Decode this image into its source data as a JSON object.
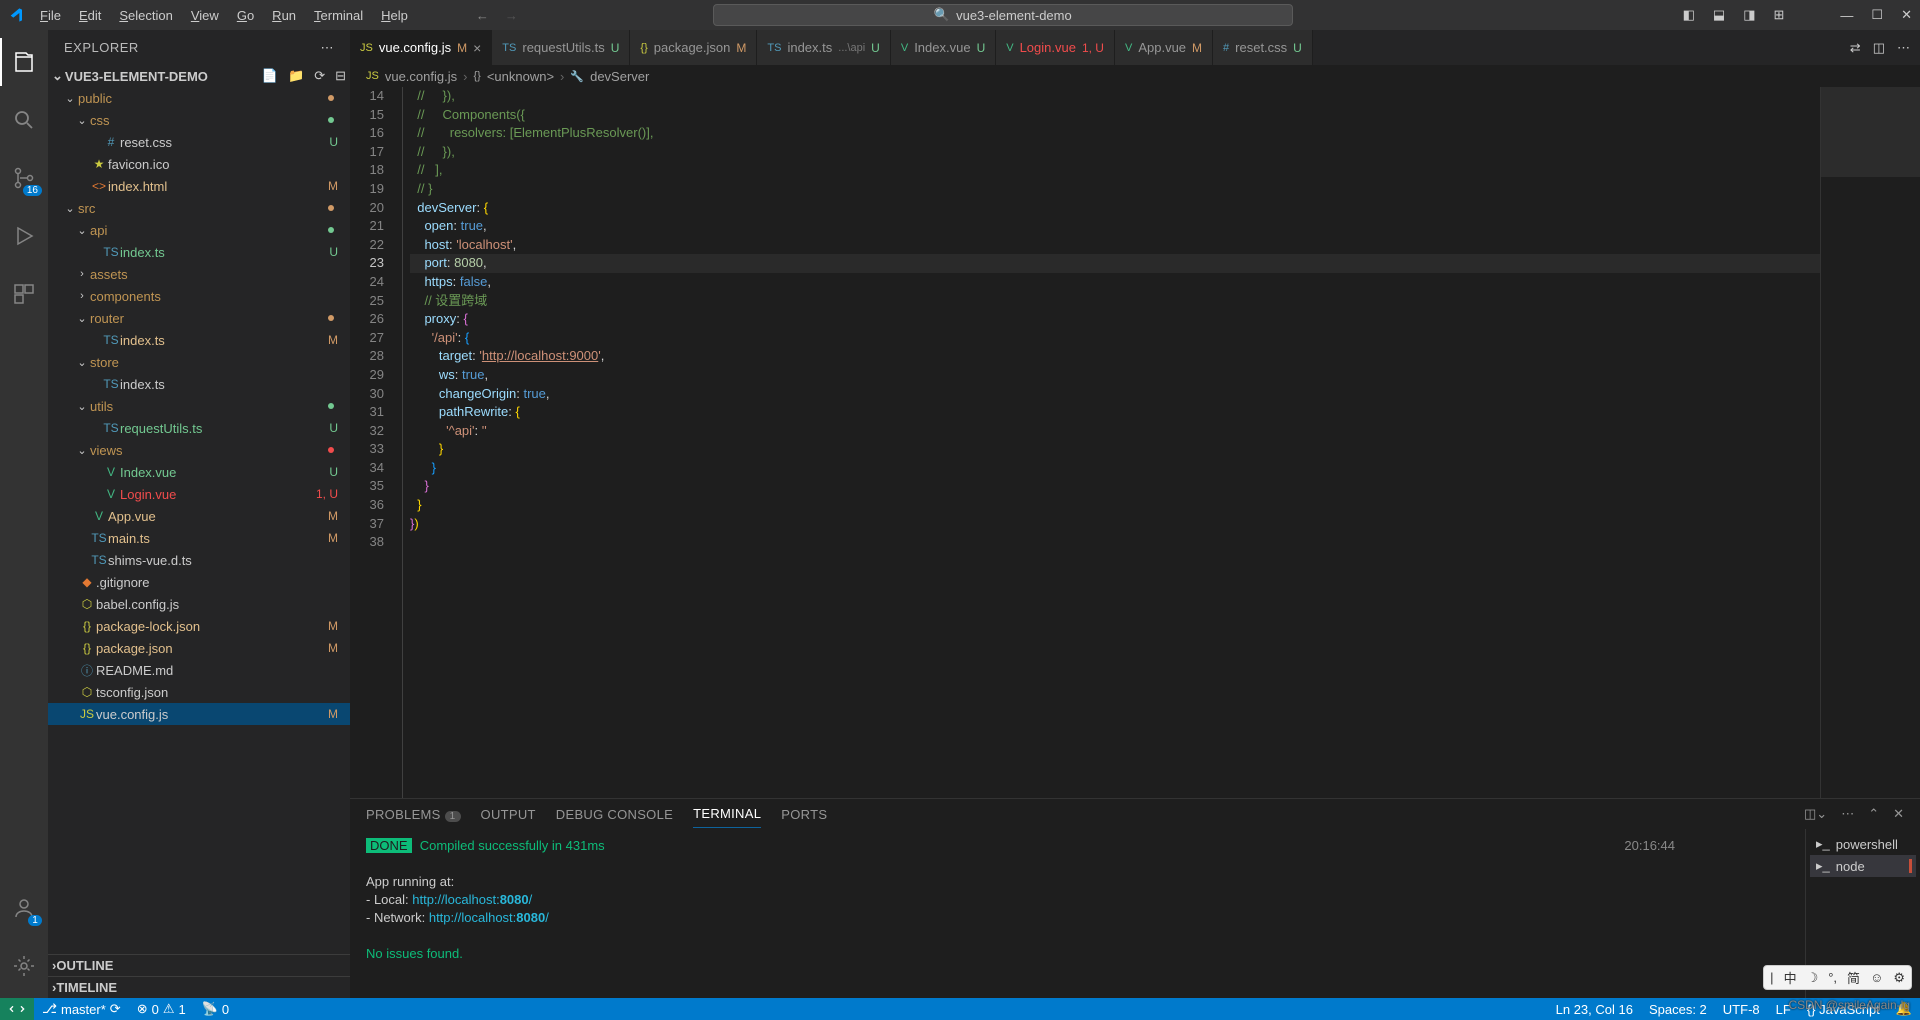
{
  "title": "vue3-element-demo",
  "menu": [
    "File",
    "Edit",
    "Selection",
    "View",
    "Go",
    "Run",
    "Terminal",
    "Help"
  ],
  "explorer": {
    "label": "EXPLORER",
    "project": "VUE3-ELEMENT-DEMO",
    "outline": "OUTLINE",
    "timeline": "TIMELINE"
  },
  "tree": [
    {
      "d": 0,
      "type": "folder",
      "open": true,
      "name": "public",
      "dot": "dot-M"
    },
    {
      "d": 1,
      "type": "folder",
      "open": true,
      "name": "css",
      "dot": "dot-U"
    },
    {
      "d": 2,
      "type": "file",
      "icon": "#",
      "cls": "col-css",
      "name": "reset.css",
      "status": "U",
      "scls": "st-U"
    },
    {
      "d": 1,
      "type": "file",
      "icon": "★",
      "cls": "col-ico",
      "name": "favicon.ico"
    },
    {
      "d": 1,
      "type": "file",
      "icon": "<>",
      "cls": "col-html",
      "name": "index.html",
      "status": "M",
      "scls": "st-M",
      "lcls": "label-yellow"
    },
    {
      "d": 0,
      "type": "folder",
      "open": true,
      "name": "src",
      "dot": "dot-M"
    },
    {
      "d": 1,
      "type": "folder",
      "open": true,
      "name": "api",
      "dot": "dot-U"
    },
    {
      "d": 2,
      "type": "file",
      "icon": "TS",
      "cls": "col-ts",
      "name": "index.ts",
      "status": "U",
      "scls": "st-U",
      "lcls": "label-green"
    },
    {
      "d": 1,
      "type": "folder",
      "open": false,
      "name": "assets"
    },
    {
      "d": 1,
      "type": "folder",
      "open": false,
      "name": "components"
    },
    {
      "d": 1,
      "type": "folder",
      "open": true,
      "name": "router",
      "dot": "dot-M"
    },
    {
      "d": 2,
      "type": "file",
      "icon": "TS",
      "cls": "col-ts",
      "name": "index.ts",
      "status": "M",
      "scls": "st-M",
      "lcls": "label-yellow"
    },
    {
      "d": 1,
      "type": "folder",
      "open": true,
      "name": "store"
    },
    {
      "d": 2,
      "type": "file",
      "icon": "TS",
      "cls": "col-ts",
      "name": "index.ts"
    },
    {
      "d": 1,
      "type": "folder",
      "open": true,
      "name": "utils",
      "dot": "dot-U"
    },
    {
      "d": 2,
      "type": "file",
      "icon": "TS",
      "cls": "col-ts",
      "name": "requestUtils.ts",
      "status": "U",
      "scls": "st-U",
      "lcls": "label-green"
    },
    {
      "d": 1,
      "type": "folder",
      "open": true,
      "name": "views",
      "dot": "dot-1"
    },
    {
      "d": 2,
      "type": "file",
      "icon": "V",
      "cls": "col-vue",
      "name": "Index.vue",
      "status": "U",
      "scls": "st-U",
      "lcls": "label-green"
    },
    {
      "d": 2,
      "type": "file",
      "icon": "V",
      "cls": "col-vue",
      "name": "Login.vue",
      "status": "1, U",
      "scls": "st-1U",
      "lcls": "label-red"
    },
    {
      "d": 1,
      "type": "file",
      "icon": "V",
      "cls": "col-vue",
      "name": "App.vue",
      "status": "M",
      "scls": "st-M",
      "lcls": "label-yellow"
    },
    {
      "d": 1,
      "type": "file",
      "icon": "TS",
      "cls": "col-ts",
      "name": "main.ts",
      "status": "M",
      "scls": "st-M",
      "lcls": "label-yellow"
    },
    {
      "d": 1,
      "type": "file",
      "icon": "TS",
      "cls": "col-ts",
      "name": "shims-vue.d.ts"
    },
    {
      "d": 0,
      "type": "file",
      "icon": "◆",
      "cls": "col-git",
      "name": ".gitignore"
    },
    {
      "d": 0,
      "type": "file",
      "icon": "⬡",
      "cls": "col-js",
      "name": "babel.config.js"
    },
    {
      "d": 0,
      "type": "file",
      "icon": "{}",
      "cls": "col-json",
      "name": "package-lock.json",
      "status": "M",
      "scls": "st-M",
      "lcls": "label-yellow"
    },
    {
      "d": 0,
      "type": "file",
      "icon": "{}",
      "cls": "col-json",
      "name": "package.json",
      "status": "M",
      "scls": "st-M",
      "lcls": "label-yellow"
    },
    {
      "d": 0,
      "type": "file",
      "icon": "ⓘ",
      "cls": "col-info",
      "name": "README.md"
    },
    {
      "d": 0,
      "type": "file",
      "icon": "⬡",
      "cls": "col-json",
      "name": "tsconfig.json"
    },
    {
      "d": 0,
      "type": "file",
      "icon": "JS",
      "cls": "col-js",
      "name": "vue.config.js",
      "status": "M",
      "scls": "st-M",
      "sel": true
    }
  ],
  "tabs": [
    {
      "icon": "JS",
      "cls": "col-js",
      "name": "vue.config.js",
      "st": "M",
      "scls": "st-M",
      "active": true,
      "close": true
    },
    {
      "icon": "TS",
      "cls": "col-ts",
      "name": "requestUtils.ts",
      "st": "U",
      "scls": "st-U"
    },
    {
      "icon": "{}",
      "cls": "col-json",
      "name": "package.json",
      "st": "M",
      "scls": "st-M"
    },
    {
      "icon": "TS",
      "cls": "col-ts",
      "name": "index.ts",
      "suffix": "...\\api",
      "st": "U",
      "scls": "st-U"
    },
    {
      "icon": "V",
      "cls": "col-vue",
      "name": "Index.vue",
      "st": "U",
      "scls": "st-U"
    },
    {
      "icon": "V",
      "cls": "col-vue",
      "name": "Login.vue",
      "ncls": "tlbl-red",
      "st": "1, U",
      "scls": "st-1U"
    },
    {
      "icon": "V",
      "cls": "col-vue",
      "name": "App.vue",
      "st": "M",
      "scls": "st-M"
    },
    {
      "icon": "#",
      "cls": "col-css",
      "name": "reset.css",
      "st": "U",
      "scls": "st-U"
    }
  ],
  "breadcrumb": [
    {
      "icon": "JS",
      "cls": "col-js",
      "name": "vue.config.js"
    },
    {
      "icon": "{}",
      "cls": "",
      "name": "<unknown>"
    },
    {
      "icon": "🔧",
      "cls": "",
      "name": "devServer"
    }
  ],
  "code_start": 14,
  "panel": {
    "tabs": [
      "PROBLEMS",
      "OUTPUT",
      "DEBUG CONSOLE",
      "TERMINAL",
      "PORTS"
    ],
    "badge": "1",
    "active": "TERMINAL"
  },
  "terminal": {
    "done": "DONE",
    "compiled": "Compiled successfully in 431ms",
    "time": "20:16:44",
    "running": "App running at:",
    "local_lbl": "- Local:   ",
    "local_url": "http://localhost:",
    "local_port": "8080",
    "net_lbl": "- Network: ",
    "net_url": "http://localhost:",
    "net_port": "8080",
    "noissues": "No issues found.",
    "shells": [
      "powershell",
      "node"
    ]
  },
  "status": {
    "branch": "master*",
    "sync": "⟳",
    "errors": "0",
    "warnings": "1",
    "ports": "0",
    "lncol": "Ln 23, Col 16",
    "spaces": "Spaces: 2",
    "encoding": "UTF-8",
    "eol": "LF",
    "lang": "{} JavaScript",
    "bell": "🔔"
  },
  "scm_badge": "16",
  "acct_badge": "1",
  "watermark": "CSDN @smileAgain-lg",
  "ime": [
    "|",
    "中",
    "☽",
    "°,",
    "简",
    "☺",
    "⚙"
  ]
}
